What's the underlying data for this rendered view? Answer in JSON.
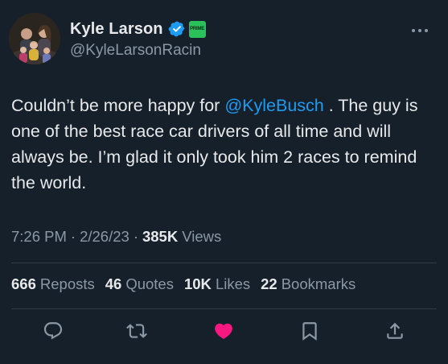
{
  "colors": {
    "background": "#15202b",
    "text": "#e7e9ea",
    "secondary_text": "#8b98a5",
    "accent": "#1d9bf0",
    "like": "#f91880",
    "prime_badge": "#29c15a"
  },
  "author": {
    "display_name": "Kyle Larson",
    "handle": "@KyleLarsonRacin",
    "verified_icon": "verified-badge-icon",
    "badge_text": "PRIME"
  },
  "tweet": {
    "text_before_mention": "Couldn’t be more happy for ",
    "mention": "@KyleBusch",
    "text_after_mention": " . The guy is one of the best race car drivers of all time and will always be. I’m glad it only took him 2 races to remind the world."
  },
  "meta": {
    "time": "7:26 PM",
    "separator": "·",
    "date": "2/26/23",
    "views_count": "385K",
    "views_label": "Views"
  },
  "stats": {
    "reposts_count": "666",
    "reposts_label": "Reposts",
    "quotes_count": "46",
    "quotes_label": "Quotes",
    "likes_count": "10K",
    "likes_label": "Likes",
    "bookmarks_count": "22",
    "bookmarks_label": "Bookmarks"
  },
  "actions": [
    "reply-icon",
    "repost-icon",
    "like-icon",
    "bookmark-icon",
    "share-icon"
  ]
}
